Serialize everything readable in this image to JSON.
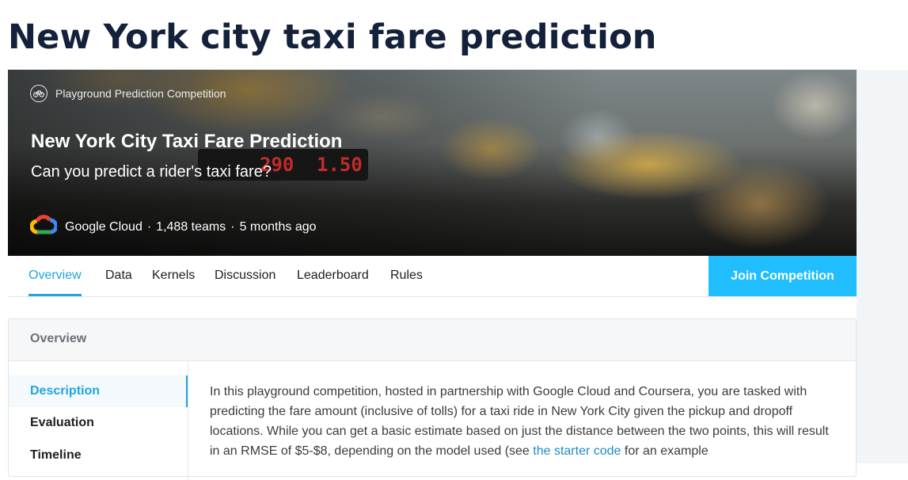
{
  "page": {
    "title": "New York city taxi fare prediction"
  },
  "banner": {
    "badge": "Playground Prediction Competition",
    "title": "New York City Taxi Fare Prediction",
    "subtitle": "Can you predict a rider's taxi fare?",
    "meter_left": "290",
    "meter_right": "1.50",
    "host": "Google Cloud",
    "sep": "·",
    "teams": "1,488 teams",
    "age": "5 months ago"
  },
  "tabs": {
    "overview": "Overview",
    "data": "Data",
    "kernels": "Kernels",
    "discussion": "Discussion",
    "leaderboard": "Leaderboard",
    "rules": "Rules",
    "active": "Overview"
  },
  "join_button": "Join Competition",
  "overview": {
    "header": "Overview",
    "sidebar": {
      "description": "Description",
      "evaluation": "Evaluation",
      "timeline": "Timeline",
      "active": "Description"
    },
    "text_1": "In this playground competition, hosted in partnership with Google Cloud and Coursera, you are tasked with predicting the fare amount (inclusive of tolls) for a taxi ride in New York City given the pickup and dropoff locations. While you can get a basic estimate based on just the distance between the two points, this will result in an RMSE of $5-$8, depending on the model used (see ",
    "link": "the starter code",
    "text_2": " for an example"
  },
  "colors": {
    "accent": "#20beff",
    "link": "#1f8bc6",
    "title": "#14213a"
  },
  "icons": [
    "bicycle-icon",
    "google-cloud-logo-icon"
  ]
}
